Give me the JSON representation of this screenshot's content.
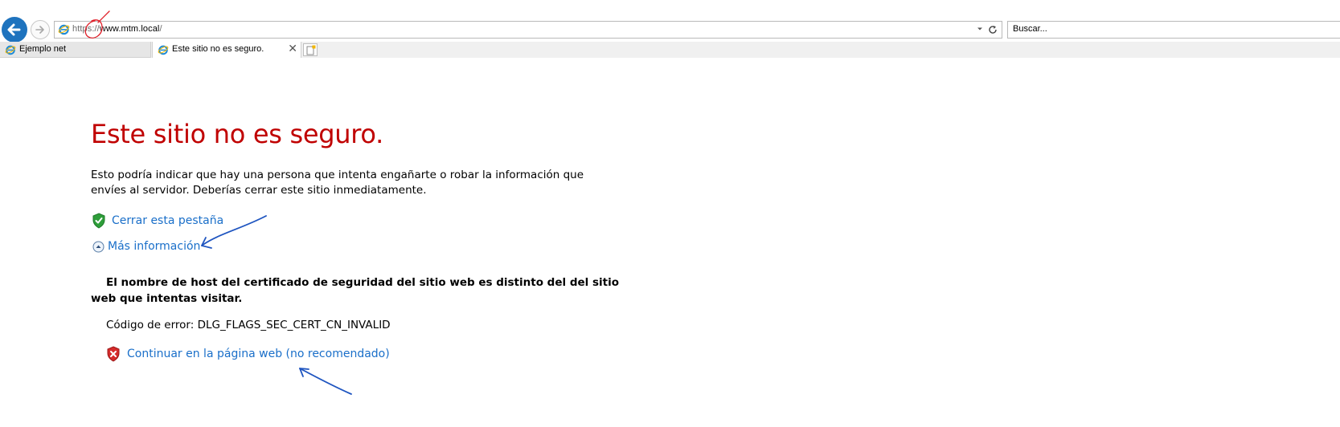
{
  "browser": {
    "address": {
      "url_dim_prefix": "https://",
      "url_main": "www.mtm.local",
      "url_dim_suffix": "/"
    },
    "search": {
      "placeholder": "Buscar..."
    },
    "tabs": [
      {
        "label": "Ejemplo net",
        "active": false
      },
      {
        "label": "Este sitio no es seguro.",
        "active": true
      }
    ]
  },
  "page": {
    "title": "Este sitio no es seguro.",
    "description": "Esto podría indicar que hay una persona que intenta engañarte o robar la información que envíes al servidor. Deberías cerrar este sitio inmediatamente.",
    "close_tab_link": "Cerrar esta pestaña",
    "more_info_link": "Más información",
    "detail": "El nombre de host del certificado de seguridad del sitio web es distinto del del sitio web que intentas visitar.",
    "error_code": "Código de error: DLG_FLAGS_SEC_CERT_CN_INVALID",
    "continue_link": "Continuar en la página web (no recomendado)"
  },
  "icons": {
    "back": "back-arrow-icon",
    "forward": "forward-arrow-icon",
    "ie": "internet-explorer-icon",
    "dropdown": "chevron-down-icon",
    "refresh": "refresh-icon",
    "close_tab": "close-icon",
    "new_tab": "new-tab-icon",
    "shield_ok": "green-shield-check-icon",
    "collapse": "circle-chevron-up-icon",
    "shield_error": "red-shield-x-icon"
  },
  "colors": {
    "title_red": "#c00000",
    "link_blue": "#1a6fc9",
    "annotation_blue": "#1f55c0",
    "annotation_red": "#e0202a"
  }
}
